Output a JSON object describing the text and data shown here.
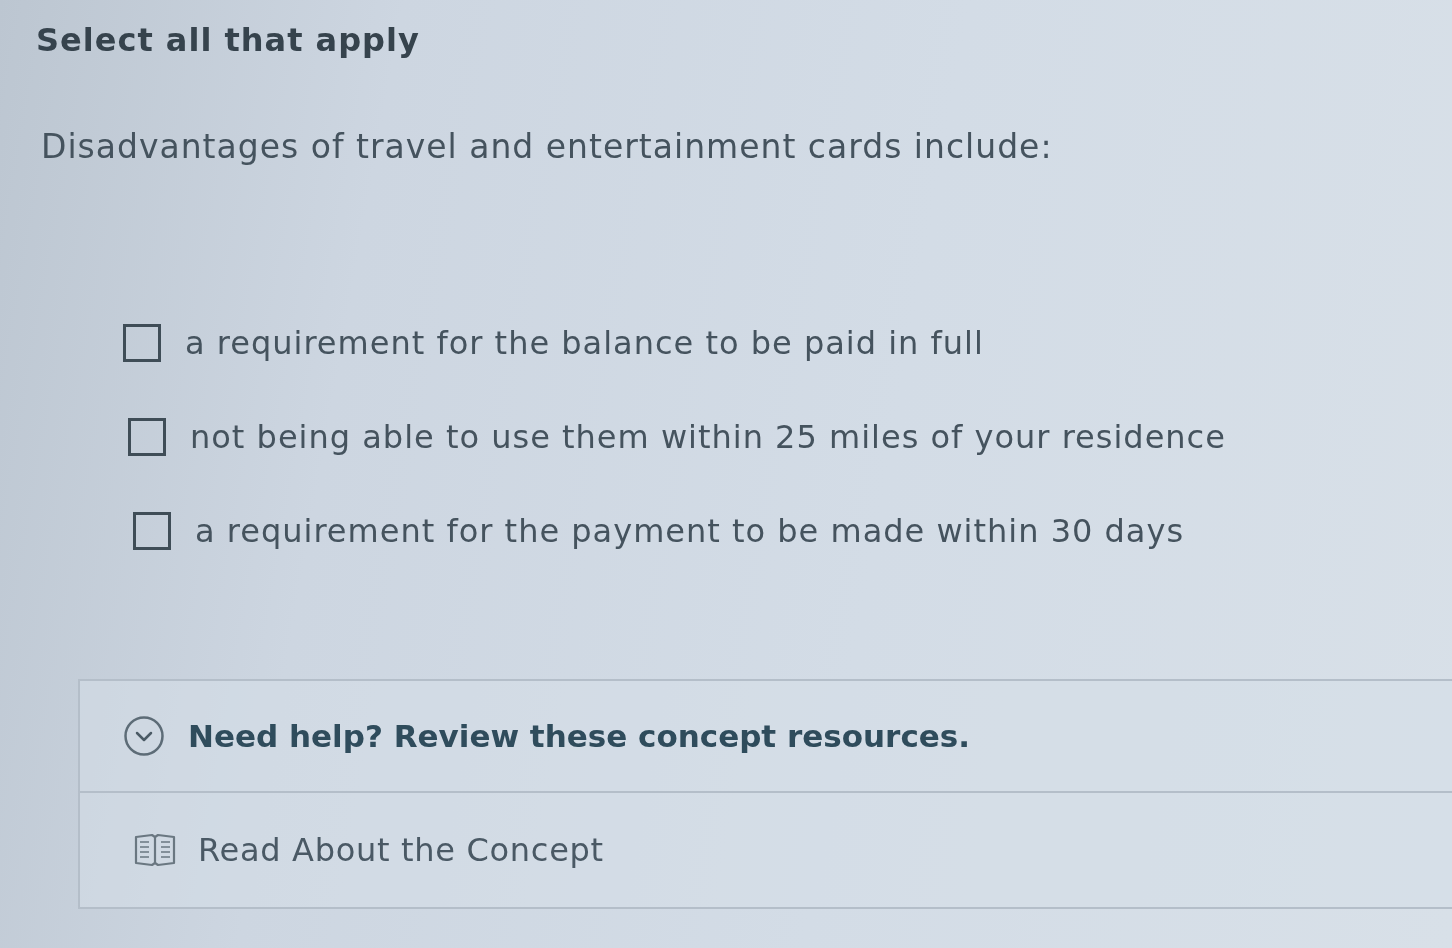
{
  "instruction": "Select all that apply",
  "question": "Disadvantages of travel and entertainment cards include:",
  "options": [
    {
      "label": "a requirement for the balance to be paid in full",
      "checked": false
    },
    {
      "label": "not being able to use them within 25 miles of your residence",
      "checked": false
    },
    {
      "label": "a requirement for the payment to be made within 30 days",
      "checked": false
    }
  ],
  "help": {
    "title": "Need help? Review these concept resources.",
    "expanded": true,
    "resources": [
      {
        "label": "Read About the Concept"
      }
    ]
  }
}
